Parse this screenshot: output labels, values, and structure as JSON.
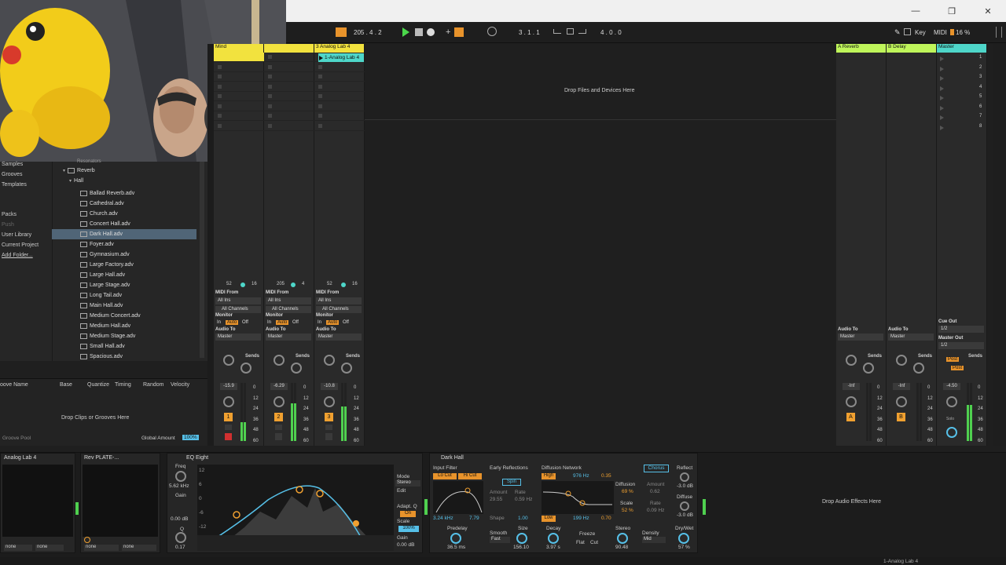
{
  "titlebar": {
    "controls": [
      "—",
      "❐",
      "✕"
    ]
  },
  "toolbar": {
    "tempo_nudge": "205 .   4 .   2",
    "position": "3 .   1 .   1",
    "loop_length": "4 .   0 .   0",
    "key_label": "Key",
    "midi_label": "MIDI",
    "cpu": "16 %"
  },
  "browser": {
    "sidebar": [
      "Samples",
      "Grooves",
      "Templates",
      "Packs",
      "Push",
      "User Library",
      "Current Project",
      "Add Folder..."
    ],
    "tree_partial": "Resonators",
    "reverb": "Reverb",
    "hall": "Hall",
    "files": [
      "Ballad Reverb.adv",
      "Cathedral.adv",
      "Church.adv",
      "Concert Hall.adv",
      "Dark Hall.adv",
      "Foyer.adv",
      "Gymnasium.adv",
      "Large Factory.adv",
      "Large Hall.adv",
      "Large Stage.adv",
      "Long Tail.adv",
      "Main Hall.adv",
      "Medium Concert.adv",
      "Medium Hall.adv",
      "Medium Stage.adv",
      "Small Hall.adv",
      "Spacious.adv"
    ],
    "selected_index": 4
  },
  "groove": {
    "headers": [
      "oove Name",
      "Base",
      "Quantize",
      "Timing",
      "Random",
      "Velocity"
    ],
    "drop": "Drop Clips or Grooves Here",
    "pool": "Groove Pool",
    "global_amount_label": "Global Amount",
    "global_amount": "100%"
  },
  "tracks": [
    {
      "name": "Mind",
      "clip": "",
      "color": "#f2e23e",
      "num": "1",
      "volume": "-15.9",
      "top_a": "52",
      "top_b": "16",
      "io": {
        "midi_from": "MIDI From",
        "all_ins": "All Ins",
        "channels": "All Channels",
        "monitor": "Monitor",
        "in": "In",
        "auto": "Auto",
        "off": "Off",
        "audio_to": "Audio To",
        "master": "Master"
      }
    },
    {
      "name": "",
      "clip": "",
      "color": "#f2e23e",
      "num": "2",
      "volume": "-6.29",
      "top_a": "205",
      "top_b": "4",
      "io": {
        "midi_from": "MIDI From",
        "all_ins": "All Ins",
        "channels": "All Channels",
        "monitor": "Monitor",
        "in": "In",
        "auto": "Auto",
        "off": "Off",
        "audio_to": "Audio To",
        "master": "Master"
      }
    },
    {
      "name": "3 Analog Lab 4",
      "clip": "1-Analog Lab 4",
      "color": "#f2e23e",
      "num": "3",
      "volume": "-10.8",
      "top_a": "52",
      "top_b": "16",
      "io": {
        "midi_from": "MIDI From",
        "all_ins": "All Ins",
        "channels": "All Channels",
        "monitor": "Monitor",
        "in": "In",
        "auto": "Auto",
        "off": "Off",
        "audio_to": "Audio To",
        "master": "Master"
      }
    }
  ],
  "sends_label": "Sends",
  "db_scale": [
    "0",
    "12",
    "24",
    "36",
    "48",
    "60"
  ],
  "main_drop": "Drop Files and Devices Here",
  "returns": [
    {
      "name": "A Reverb",
      "letter": "A",
      "volume": "-Inf",
      "color": "#bff55a"
    },
    {
      "name": "B Delay",
      "letter": "B",
      "volume": "-Inf",
      "color": "#bff55a"
    }
  ],
  "master": {
    "name": "Master",
    "color": "#4ed6c9",
    "volume": "-4.50",
    "cue_out": "Cue Out",
    "cue_val": "1/2",
    "master_out": "Master Out",
    "master_val": "1/2",
    "post": "Post",
    "solo": "Solo",
    "scenes": [
      "1",
      "2",
      "3",
      "4",
      "5",
      "6",
      "7",
      "8"
    ]
  },
  "audio_to": "Audio To",
  "master_sel": "Master",
  "devices": {
    "analog": {
      "title": "Analog Lab 4",
      "sel": "none",
      "sel2": "none"
    },
    "rev": {
      "title": "Rev PLATE-...",
      "sel": "none",
      "sel2": "none"
    },
    "eq": {
      "title": "EQ Eight",
      "freq_label": "Freq",
      "freq": "5.62 kHz",
      "gain_label": "Gain",
      "gain": "0.00 dB",
      "q_label": "Q",
      "q": "0.17",
      "mode_label": "Mode",
      "mode": "Stereo",
      "edit": "Edit",
      "adapt": "Adapt. Q",
      "adapt_val": "On",
      "scale_label": "Scale",
      "scale": "100%",
      "gain2_label": "Gain",
      "gain2": "0.00 dB",
      "db": [
        "12",
        "6",
        "0",
        "-6",
        "-12"
      ]
    },
    "hall": {
      "title": "Dark Hall",
      "input_filter": "Input Filter",
      "locut": "Lo Cut",
      "hicut": "Hi Cut",
      "freq": "3.24 kHz",
      "q": "7.79",
      "early": "Early Reflections",
      "spin": "Spin",
      "amount_label": "Amount",
      "amount": "29.55",
      "rate_label": "Rate",
      "rate": "0.59 Hz",
      "shape_label": "Shape",
      "shape": "1.00",
      "diffusion": "Diffusion Network",
      "high": "High",
      "hi_freq": "976 Hz",
      "hi_val": "0.35",
      "low": "Low",
      "lo_freq": "199 Hz",
      "lo_val": "0.70",
      "diff_label": "Diffusion",
      "diff_val": "69 %",
      "scale_label": "Scale",
      "scale_val": "52 %",
      "chorus": "Chorus",
      "ch_amount_label": "Amount",
      "ch_amount": "0.62",
      "ch_rate_label": "Rate",
      "ch_rate": "0.09 Hz",
      "reflect": "Reflect",
      "reflect_val": "-3.0 dB",
      "diffuse": "Diffuse",
      "diffuse_val": "-3.0 dB",
      "predelay": "Predelay",
      "predelay_val": "36.5 ms",
      "smooth": "Smooth",
      "smooth_val": "Fast",
      "size": "Size",
      "size_val": "156.10",
      "decay": "Decay",
      "decay_val": "3.97 s",
      "freeze": "Freeze",
      "flat": "Flat",
      "cut": "Cut",
      "stereo": "Stereo",
      "stereo_val": "90.48",
      "density": "Density",
      "density_val": "Mid",
      "drywet": "Dry/Wet",
      "drywet_val": "57 %"
    },
    "drop_fx": "Drop Audio Effects Here"
  },
  "status": {
    "right": "1-Analog Lab 4"
  }
}
